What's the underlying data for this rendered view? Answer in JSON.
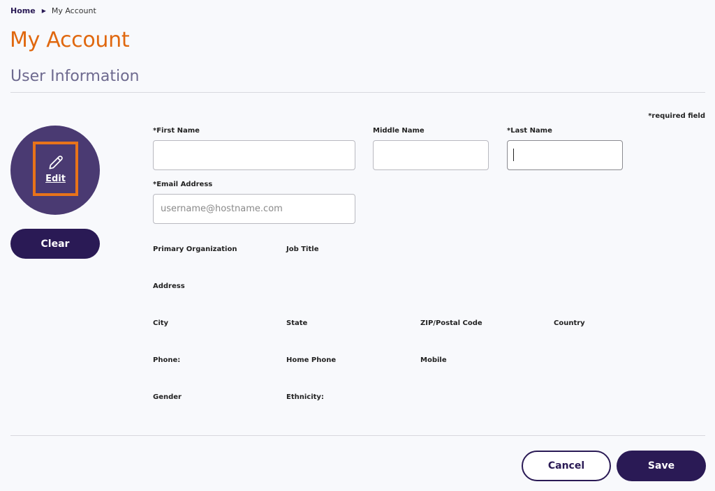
{
  "breadcrumb": {
    "home": "Home",
    "current": "My Account"
  },
  "page_title": "My Account",
  "section_title": "User Information",
  "required_note": "*required field",
  "avatar": {
    "edit_label": "Edit",
    "icon": "pencil-icon",
    "highlight_color": "#e8731a",
    "bg_color": "#4a3a72"
  },
  "clear_label": "Clear",
  "form": {
    "first_name": {
      "label": "*First Name",
      "value": ""
    },
    "middle_name": {
      "label": "Middle Name",
      "value": ""
    },
    "last_name": {
      "label": "*Last Name",
      "value": ""
    },
    "email": {
      "label": "*Email Address",
      "placeholder": "username@hostname.com"
    },
    "primary_org": "Primary Organization",
    "job_title": "Job Title",
    "address": "Address",
    "city": "City",
    "state": "State",
    "zip": "ZIP/Postal Code",
    "country": "Country",
    "phone": "Phone:",
    "home_phone": "Home Phone",
    "mobile": "Mobile",
    "gender": "Gender",
    "ethnicity": "Ethnicity:"
  },
  "actions": {
    "cancel": "Cancel",
    "save": "Save"
  },
  "colors": {
    "primary": "#2a1a55",
    "accent": "#e0680f"
  }
}
